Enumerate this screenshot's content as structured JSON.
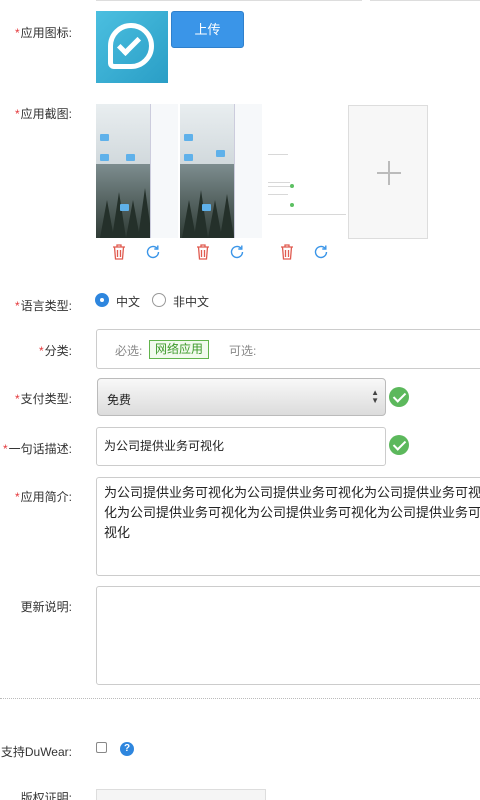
{
  "form": {
    "app_icon": {
      "label": "应用图标:",
      "required": "*",
      "upload_label": "上传"
    },
    "screenshots": {
      "label": "应用截图:",
      "required": "*"
    },
    "language": {
      "label": "语言类型:",
      "required": "*",
      "options": [
        "中文",
        "非中文"
      ],
      "selected": "中文"
    },
    "category": {
      "label": "分类:",
      "required": "*",
      "required_prefix": "必选:",
      "selected_tag": "网络应用",
      "optional_prefix": "可选:"
    },
    "payment": {
      "label": "支付类型:",
      "required": "*",
      "value": "免费"
    },
    "tagline": {
      "label": "一句话描述:",
      "required": "*",
      "value": "为公司提供业务可视化"
    },
    "intro": {
      "label": "应用简介:",
      "required": "*",
      "value": "为公司提供业务可视化为公司提供业务可视化为公司提供业务可视化为公司提供业务可视化为公司提供业务可视化为公司提供业务可视化"
    },
    "update_notes": {
      "label": "更新说明:",
      "value": ""
    },
    "duwear": {
      "label": "支持DuWear:",
      "checked": false,
      "help_icon_text": "?"
    },
    "copyright": {
      "label": "版权证明:"
    }
  },
  "icons": {
    "delete": "trash-icon",
    "refresh": "refresh-icon",
    "valid": "check-circle-icon",
    "add": "plus-icon",
    "help": "question-circle-icon"
  },
  "colors": {
    "required": "#e4393c",
    "primary": "#3a95e8",
    "success": "#5cb85c",
    "tag_green": "#3e9a2b"
  }
}
